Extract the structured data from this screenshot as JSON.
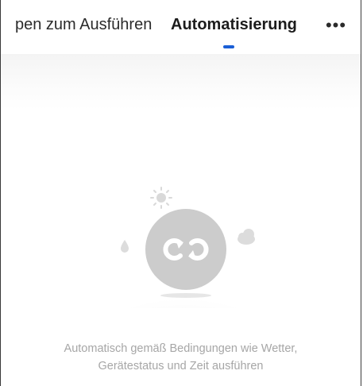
{
  "tabs": {
    "previous_label": "pen zum Ausführen",
    "active_label": "Automatisierung",
    "more_label": "•••"
  },
  "colors": {
    "accent": "#1a5fd6",
    "illustration_gray": "#cccccc"
  },
  "empty_state": {
    "icons": [
      "sun-icon",
      "drop-icon",
      "cloud-icon",
      "automation-loop-icon"
    ],
    "line1": "Automatisch gemäß Bedingungen wie Wetter,",
    "line2": "Gerätestatus und Zeit ausführen"
  }
}
